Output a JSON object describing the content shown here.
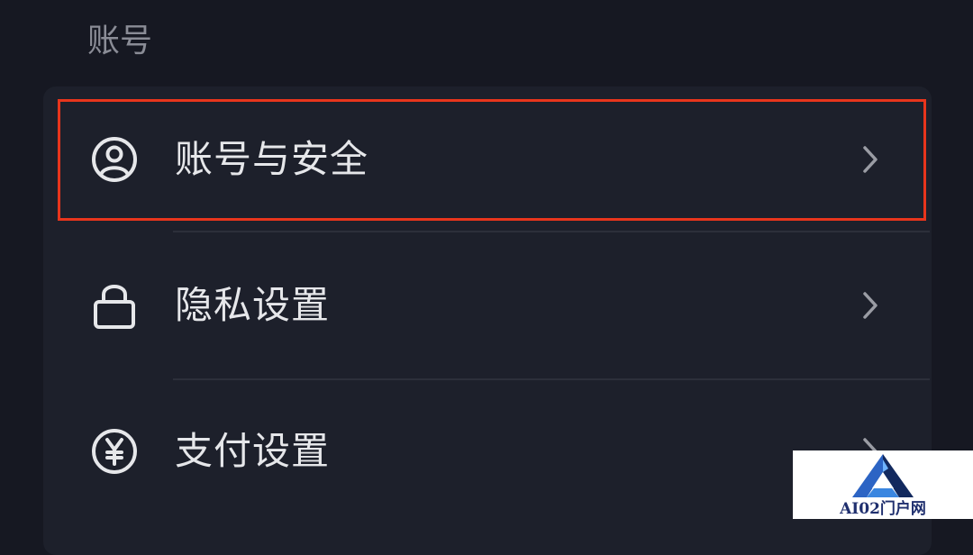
{
  "section": {
    "title": "账号"
  },
  "settings_rows": [
    {
      "label": "账号与安全",
      "icon": "user-circle-icon"
    },
    {
      "label": "隐私设置",
      "icon": "lock-icon"
    },
    {
      "label": "支付设置",
      "icon": "yen-circle-icon"
    }
  ],
  "highlight": {
    "color": "#e8351c",
    "target": "账号与安全"
  },
  "watermark": {
    "text": "AI02门户网",
    "logo": "a-logo-icon"
  },
  "colors": {
    "background": "#161822",
    "card": "#1d202b",
    "text": "#e6e7ea",
    "muted": "#8a8c96",
    "chevron": "#9a9ca4"
  }
}
